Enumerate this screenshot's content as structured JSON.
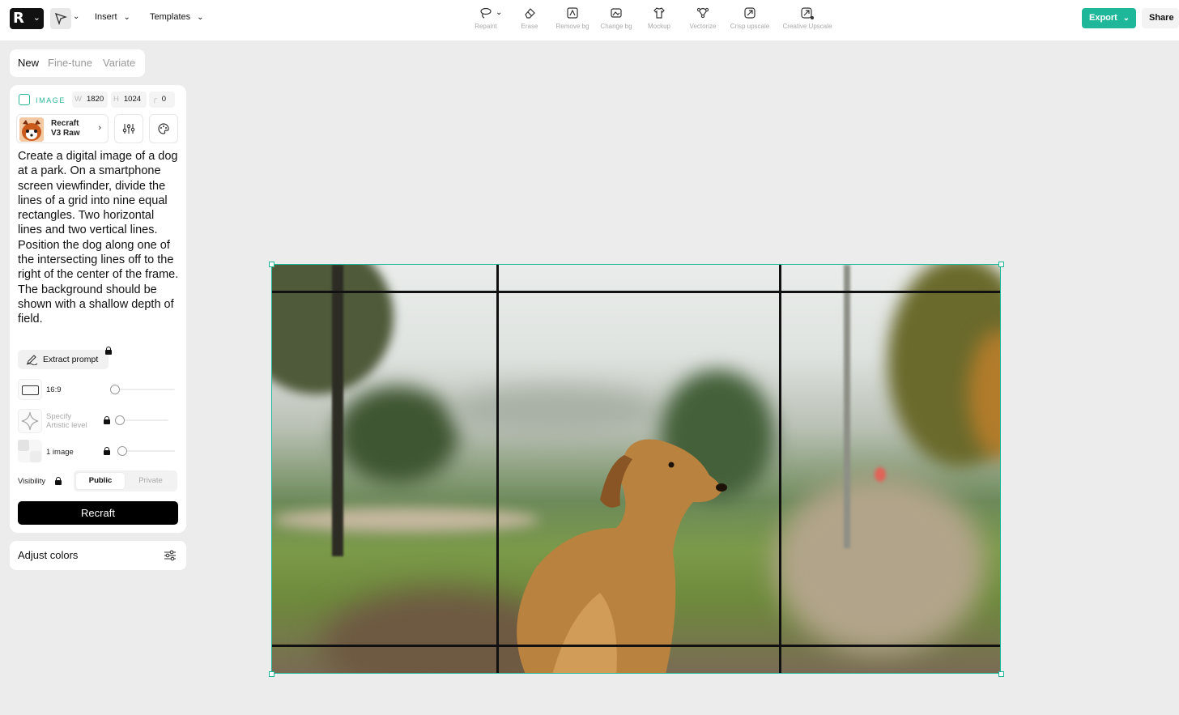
{
  "toolbar": {
    "insert_label": "Insert",
    "templates_label": "Templates",
    "tools": [
      {
        "label": "Repaint",
        "icon": "lasso-icon"
      },
      {
        "label": "Erase",
        "icon": "eraser-icon"
      },
      {
        "label": "Remove bg",
        "icon": "remove-bg-icon"
      },
      {
        "label": "Change bg",
        "icon": "change-bg-icon"
      },
      {
        "label": "Mockup",
        "icon": "tshirt-icon"
      },
      {
        "label": "Vectorize",
        "icon": "vectorize-icon"
      },
      {
        "label": "Crisp upscale",
        "icon": "crisp-upscale-icon"
      },
      {
        "label": "Creative Upscale",
        "icon": "creative-upscale-icon"
      }
    ],
    "export_label": "Export",
    "share_label": "Share"
  },
  "mode_tabs": [
    "New",
    "Fine-tune",
    "Variate"
  ],
  "panel": {
    "type_label": "IMAGE",
    "width_key": "W",
    "width": "1820",
    "height_key": "H",
    "height": "1024",
    "corner_key": "╭",
    "corner": "0",
    "model_line1": "Recraft",
    "model_line2": "V3 Raw",
    "prompt": "Create a digital image of a dog at a park. On a smartphone screen viewfinder, divide the lines of a grid into nine equal rectangles. Two horizontal lines and two vertical lines. Position the dog along one of the intersecting lines off to the right of the center of the frame. The background should be shown with a shallow depth of field.",
    "extract_label": "Extract prompt",
    "aspect_label": "16:9",
    "artistic_line1": "Specify",
    "artistic_line2": "Artistic level",
    "count_label": "1 image",
    "visibility_label": "Visibility",
    "public_label": "Public",
    "private_label": "Private",
    "recraft_label": "Recraft",
    "adjust_label": "Adjust colors"
  },
  "colors": {
    "accent": "#1fb79a",
    "primary_button": "#000000"
  }
}
